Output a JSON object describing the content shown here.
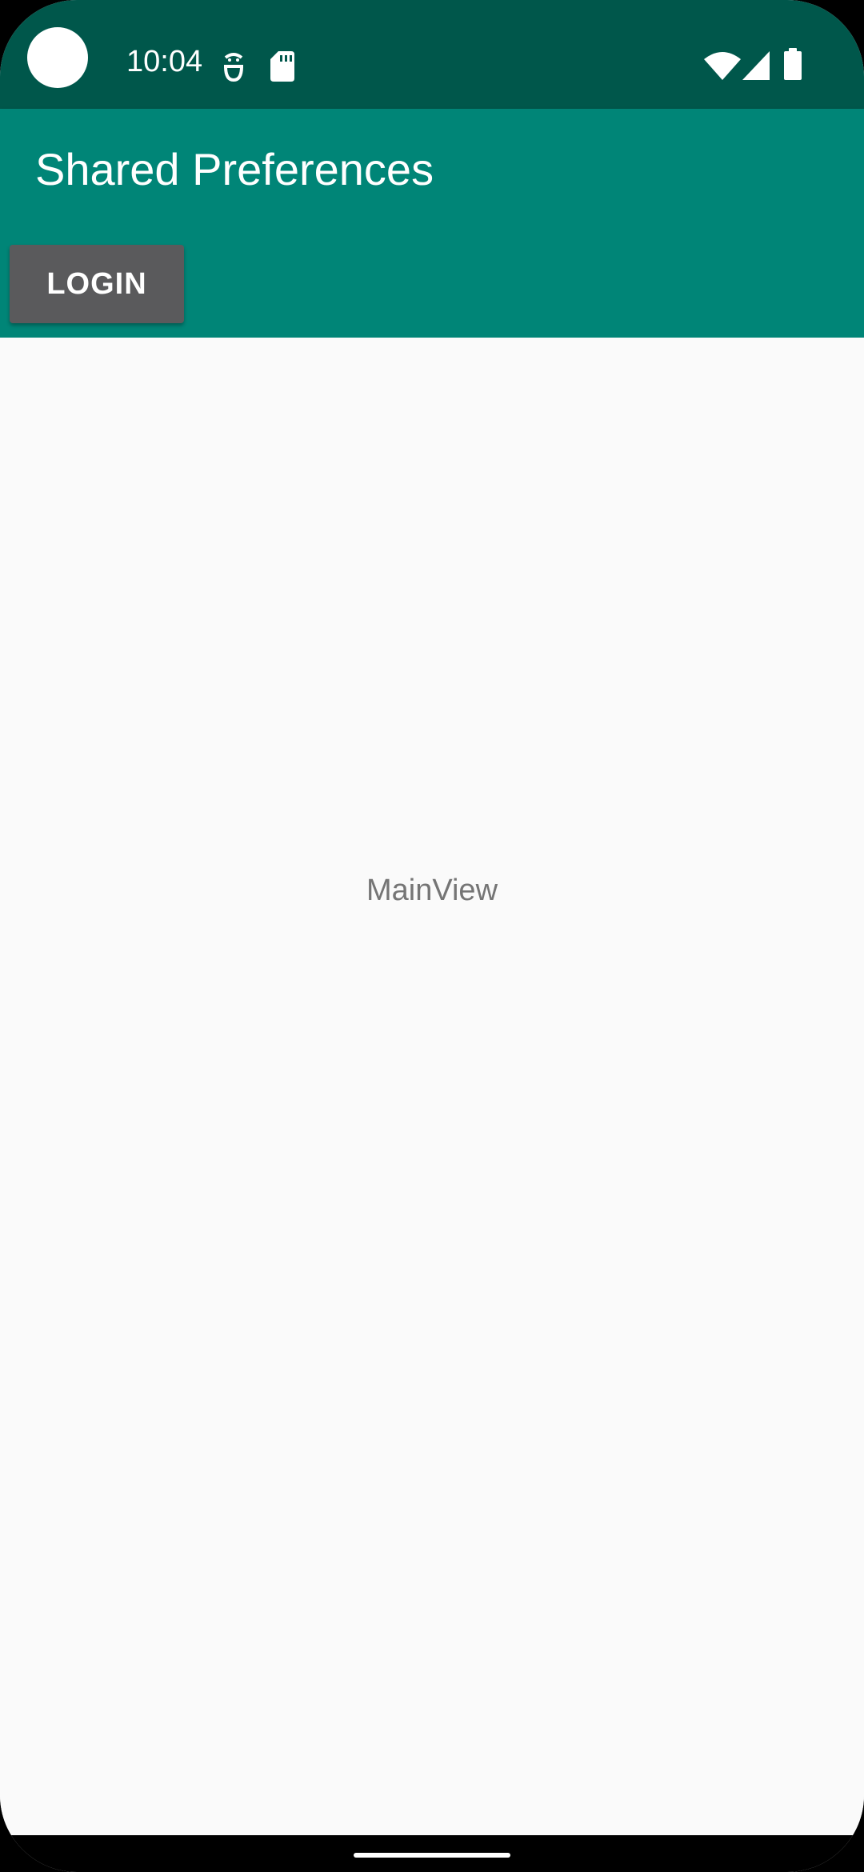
{
  "status_bar": {
    "time": "10:04",
    "background_color": "#00574b",
    "left_icons": [
      "camera-cutout",
      "debug-icon",
      "sd-card-icon"
    ],
    "right_icons": [
      "wifi-icon",
      "cellular-signal-icon",
      "battery-icon"
    ]
  },
  "app_bar": {
    "title": "Shared Preferences",
    "background_color": "#008577"
  },
  "actions": {
    "login_label": "LOGIN",
    "login_color": "#5a5a5c"
  },
  "main": {
    "label": "MainView",
    "background_color": "#fafafa"
  }
}
